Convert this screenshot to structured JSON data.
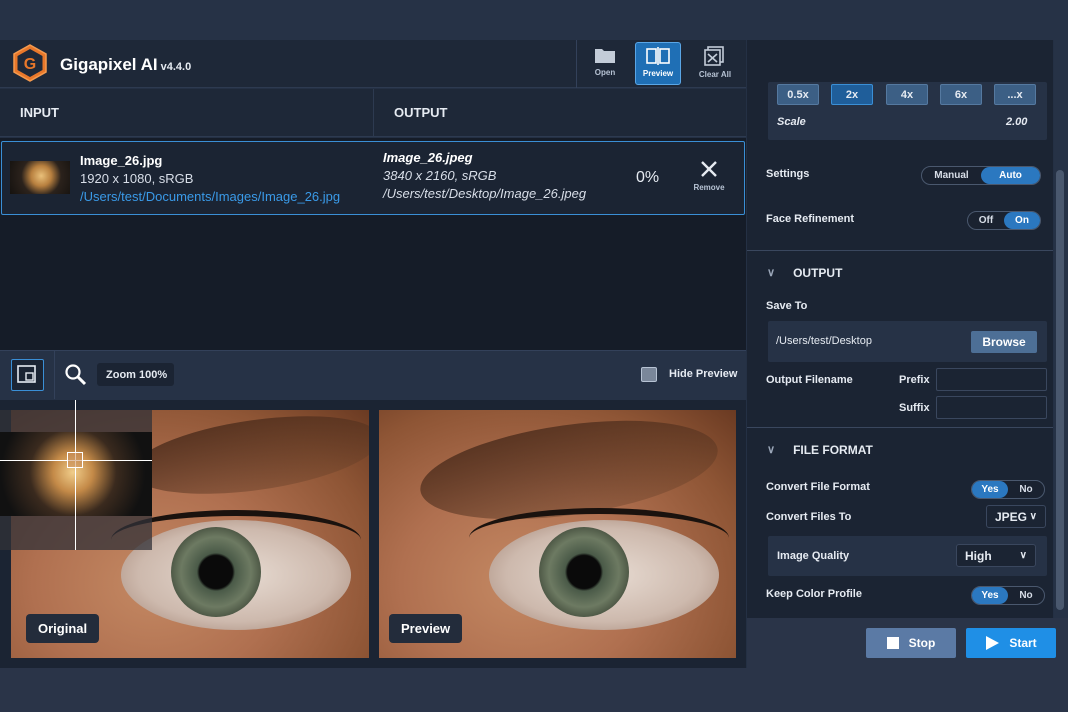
{
  "app": {
    "name": "Gigapixel AI",
    "version": "v4.4.0"
  },
  "toolbar": {
    "open": "Open",
    "preview": "Preview",
    "clear_all": "Clear All"
  },
  "columns": {
    "input": "INPUT",
    "output": "OUTPUT"
  },
  "file": {
    "in_name": "Image_26.jpg",
    "in_dims": "1920 x 1080, sRGB",
    "in_path": "/Users/test/Documents/Images/Image_26.jpg",
    "out_name": "Image_26.jpeg",
    "out_dims": "3840 x 2160, sRGB",
    "out_path": "/Users/test/Desktop/Image_26.jpeg",
    "progress": "0%",
    "remove": "Remove"
  },
  "preview": {
    "zoom": "Zoom 100%",
    "hide_preview": "Hide Preview",
    "original_label": "Original",
    "preview_label": "Preview"
  },
  "scale": {
    "options": [
      "0.5x",
      "2x",
      "4x",
      "6x",
      "...x"
    ],
    "selected": "2x",
    "label": "Scale",
    "value": "2.00"
  },
  "settings": {
    "label": "Settings",
    "manual": "Manual",
    "auto": "Auto",
    "selected": "Auto"
  },
  "face": {
    "label": "Face Refinement",
    "off": "Off",
    "on": "On",
    "selected": "On"
  },
  "output": {
    "section": "OUTPUT",
    "save_to": "Save To",
    "path": "/Users/test/Desktop",
    "browse": "Browse",
    "filename_label": "Output Filename",
    "prefix": "Prefix",
    "suffix": "Suffix"
  },
  "file_format": {
    "section": "FILE FORMAT",
    "convert_label": "Convert File Format",
    "convert_yes": "Yes",
    "convert_no": "No",
    "convert_to_label": "Convert Files To",
    "convert_to": "JPEG",
    "quality_label": "Image Quality",
    "quality": "High",
    "keep_profile_label": "Keep Color Profile",
    "keep_yes": "Yes",
    "keep_no": "No"
  },
  "actions": {
    "stop": "Stop",
    "start": "Start"
  },
  "colors": {
    "accent": "#2b78c0",
    "start": "#1f8fe6",
    "stop": "#5b7aa5",
    "link": "#3a9ae8"
  }
}
